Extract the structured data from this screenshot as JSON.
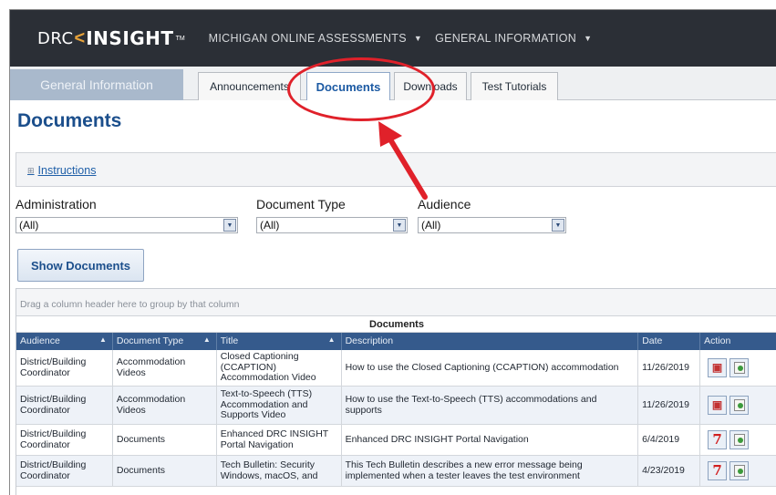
{
  "header": {
    "logo_left": "DRC",
    "logo_bracket": "<",
    "logo_right": "INSIGHT",
    "logo_tm": "TM",
    "nav": [
      {
        "label": "MICHIGAN ONLINE ASSESSMENTS",
        "caret": "▼"
      },
      {
        "label": "GENERAL INFORMATION",
        "caret": "▼"
      }
    ]
  },
  "tabs": {
    "section": "General Information",
    "items": [
      "Announcements",
      "Documents",
      "Downloads",
      "Test Tutorials"
    ],
    "active": "Documents"
  },
  "page": {
    "title": "Documents",
    "instructions_label": "Instructions",
    "instructions_expander": "⊞"
  },
  "filters": {
    "administration": {
      "label": "Administration",
      "value": "(All)"
    },
    "document_type": {
      "label": "Document Type",
      "value": "(All)"
    },
    "audience": {
      "label": "Audience",
      "value": "(All)"
    },
    "show_button": "Show Documents"
  },
  "grid": {
    "group_hint": "Drag a column header here to group by that column",
    "caption": "Documents",
    "columns": [
      "Audience",
      "Document Type",
      "Title",
      "Description",
      "Date",
      "Action"
    ],
    "sort_glyph": "▲",
    "rows": [
      {
        "audience": "District/Building Coordinator",
        "doc_type": "Accommodation Videos",
        "title": "Closed Captioning (CCAPTION) Accommodation Video",
        "description": "How to use the Closed Captioning (CCAPTION) accommodation",
        "date": "11/26/2019",
        "action_icon": "media"
      },
      {
        "audience": "District/Building Coordinator",
        "doc_type": "Accommodation Videos",
        "title": "Text-to-Speech (TTS) Accommodation and Supports Video",
        "description": "How to use the Text-to-Speech (TTS) accommodations and supports",
        "date": "11/26/2019",
        "action_icon": "media"
      },
      {
        "audience": "District/Building Coordinator",
        "doc_type": "Documents",
        "title": "Enhanced DRC INSIGHT Portal Navigation",
        "description": "Enhanced DRC INSIGHT Portal Navigation",
        "date": "6/4/2019",
        "action_icon": "pdf"
      },
      {
        "audience": "District/Building Coordinator",
        "doc_type": "Documents",
        "title": "Tech Bulletin: Security Windows, macOS, and",
        "description": "This Tech Bulletin describes a new error message being implemented when a tester leaves the test environment",
        "date": "4/23/2019",
        "action_icon": "pdf"
      }
    ]
  },
  "colors": {
    "topbar": "#2b2f36",
    "accent": "#1c5aa3",
    "grid_header": "#355a8c",
    "annotation": "#e0212a"
  },
  "icons": {
    "media": "video-document-icon",
    "pdf": "pdf-icon",
    "download": "download-icon"
  }
}
